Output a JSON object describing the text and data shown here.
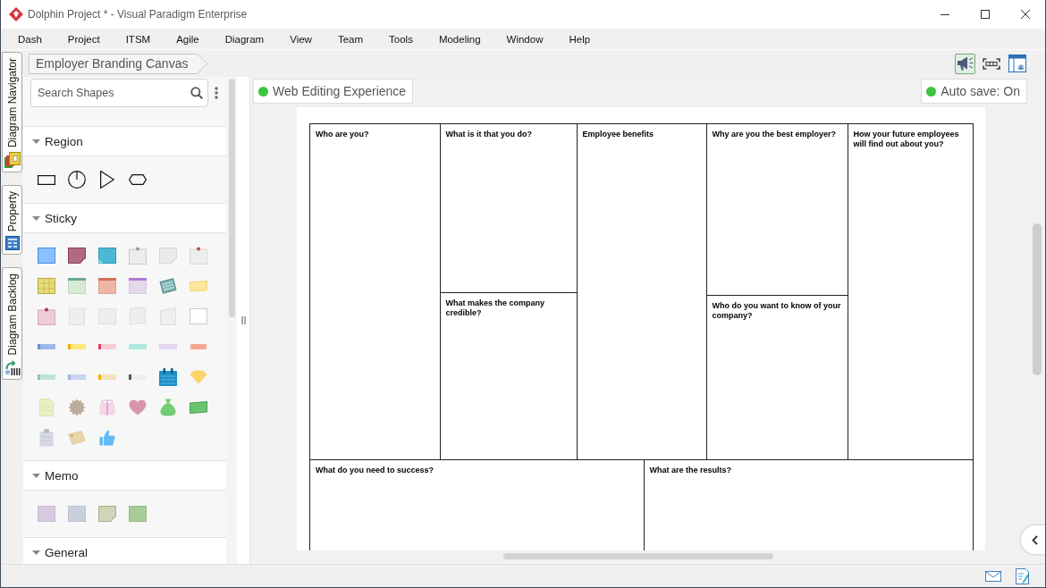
{
  "window": {
    "title": "Dolphin Project * - Visual Paradigm Enterprise"
  },
  "menu": [
    "Dash",
    "Project",
    "ITSM",
    "Agile",
    "Diagram",
    "View",
    "Team",
    "Tools",
    "Modeling",
    "Window",
    "Help"
  ],
  "side_tabs": [
    {
      "label": "Diagram Navigator",
      "kind": "navigator"
    },
    {
      "label": "Property",
      "kind": "property"
    },
    {
      "label": "Diagram Backlog",
      "kind": "backlog"
    }
  ],
  "breadcrumb": "Employer Branding Canvas",
  "toolbar": [
    {
      "kind": "megaphone",
      "selected": true
    },
    {
      "kind": "fit",
      "selected": false
    },
    {
      "kind": "layout",
      "selected": false
    }
  ],
  "shape_search": {
    "placeholder": "Search Shapes"
  },
  "palette_sections": [
    {
      "title": "Region",
      "expanded": true
    },
    {
      "title": "Sticky",
      "expanded": true
    },
    {
      "title": "Memo",
      "expanded": true
    },
    {
      "title": "General",
      "expanded": true
    }
  ],
  "canvas": {
    "mode_badge": "Web Editing Experience",
    "autosave_badge": "Auto save: On"
  },
  "diagram": {
    "columns": [
      [
        {
          "title": "Who are you?"
        }
      ],
      [
        {
          "title": "What is it that you do?"
        },
        {
          "title": "What makes the company credible?"
        }
      ],
      [
        {
          "title": "Employee benefits"
        }
      ],
      [
        {
          "title": "Why are you the best employer?"
        },
        {
          "title": "Who do you want to know of your company?"
        }
      ],
      [
        {
          "title": "How your future employees will find out about you?"
        }
      ]
    ],
    "bottom": [
      {
        "title": "What do you need to success?"
      },
      {
        "title": "What are the results?"
      }
    ]
  }
}
